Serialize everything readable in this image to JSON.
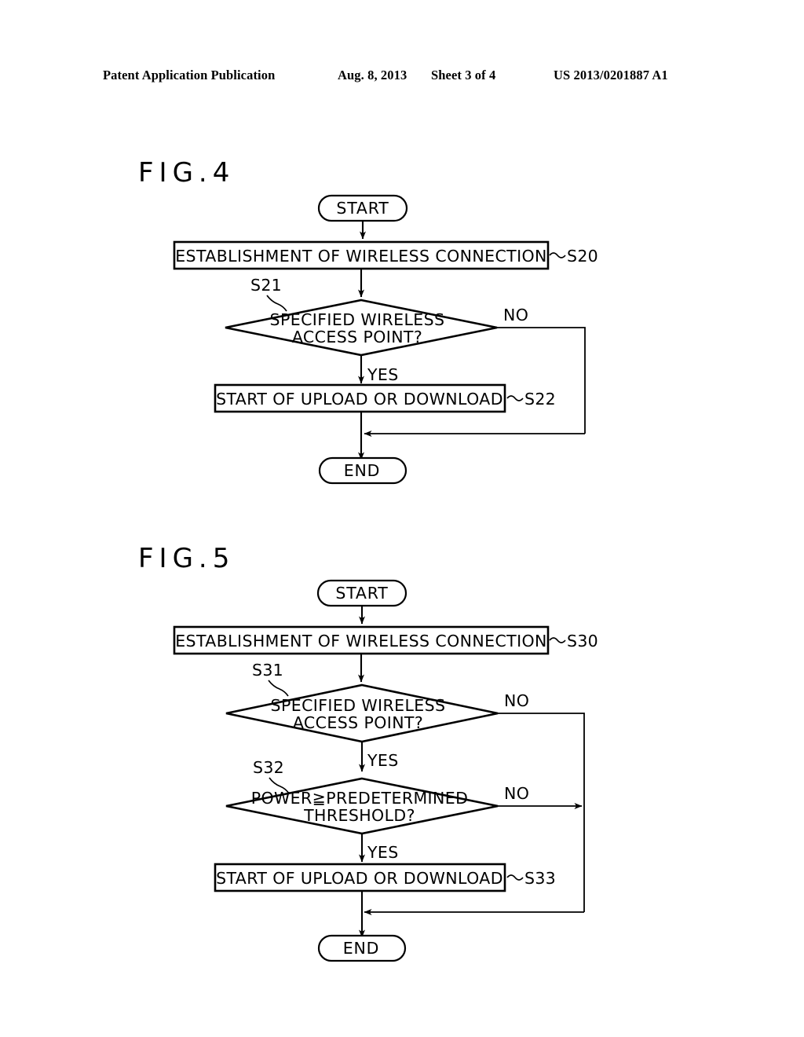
{
  "header": {
    "publication": "Patent Application Publication",
    "date": "Aug. 8, 2013",
    "sheet": "Sheet 3 of 4",
    "patent_number": "US 2013/0201887 A1"
  },
  "figures": [
    {
      "title": "FIG.4",
      "nodes": {
        "start": "START",
        "establishment": "ESTABLISHMENT OF WIRELESS CONNECTION",
        "decision1_line1": "SPECIFIED WIRELESS",
        "decision1_line2": "ACCESS POINT?",
        "upload": "START OF UPLOAD OR DOWNLOAD",
        "end": "END"
      },
      "step_labels": {
        "establishment": "S20",
        "decision1": "S21",
        "upload": "S22"
      },
      "branch_labels": {
        "decision1_no": "NO",
        "decision1_yes": "YES"
      }
    },
    {
      "title": "FIG.5",
      "nodes": {
        "start": "START",
        "establishment": "ESTABLISHMENT OF WIRELESS CONNECTION",
        "decision1_line1": "SPECIFIED WIRELESS",
        "decision1_line2": "ACCESS POINT?",
        "decision2_line1": "POWER≧PREDETERMINED",
        "decision2_line2": "THRESHOLD?",
        "upload": "START OF UPLOAD OR DOWNLOAD",
        "end": "END"
      },
      "step_labels": {
        "establishment": "S30",
        "decision1": "S31",
        "decision2": "S32",
        "upload": "S33"
      },
      "branch_labels": {
        "decision1_no": "NO",
        "decision1_yes": "YES",
        "decision2_no": "NO",
        "decision2_yes": "YES"
      }
    }
  ],
  "colors": {
    "ink": "#000000",
    "paper": "#ffffff"
  }
}
